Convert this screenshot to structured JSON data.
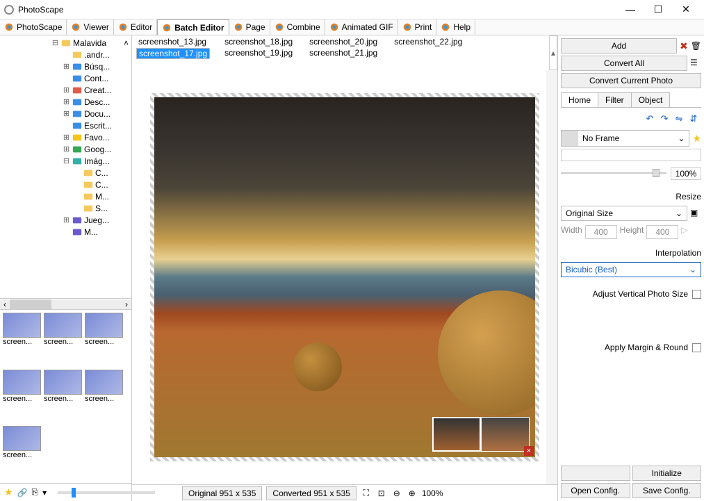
{
  "title": "PhotoScape",
  "toolbar": [
    {
      "label": "PhotoScape",
      "icon": "app-icon"
    },
    {
      "label": "Viewer",
      "icon": "viewer-icon"
    },
    {
      "label": "Editor",
      "icon": "editor-icon"
    },
    {
      "label": "Batch Editor",
      "icon": "batch-icon",
      "active": true
    },
    {
      "label": "Page",
      "icon": "page-icon"
    },
    {
      "label": "Combine",
      "icon": "combine-icon"
    },
    {
      "label": "Animated GIF",
      "icon": "gif-icon"
    },
    {
      "label": "Print",
      "icon": "print-icon"
    },
    {
      "label": "Help",
      "icon": "help-icon"
    }
  ],
  "tree": [
    {
      "indent": 0,
      "exp": "−",
      "icon": "folder",
      "label": "Malavida",
      "arrow": "^"
    },
    {
      "indent": 1,
      "exp": "",
      "icon": "folder",
      "label": ".andr..."
    },
    {
      "indent": 1,
      "exp": "+",
      "icon": "search",
      "label": "Búsq..."
    },
    {
      "indent": 1,
      "exp": "",
      "icon": "contacts",
      "label": "Cont..."
    },
    {
      "indent": 1,
      "exp": "+",
      "icon": "cloud",
      "label": "Creat..."
    },
    {
      "indent": 1,
      "exp": "+",
      "icon": "download",
      "label": "Desc..."
    },
    {
      "indent": 1,
      "exp": "+",
      "icon": "doc",
      "label": "Docu..."
    },
    {
      "indent": 1,
      "exp": "",
      "icon": "desktop",
      "label": "Escrit..."
    },
    {
      "indent": 1,
      "exp": "+",
      "icon": "star",
      "label": "Favo..."
    },
    {
      "indent": 1,
      "exp": "+",
      "icon": "gdrive",
      "label": "Goog..."
    },
    {
      "indent": 1,
      "exp": "−",
      "icon": "pictures",
      "label": "Imág..."
    },
    {
      "indent": 2,
      "exp": "",
      "icon": "folder",
      "label": "C..."
    },
    {
      "indent": 2,
      "exp": "",
      "icon": "folder",
      "label": "C..."
    },
    {
      "indent": 2,
      "exp": "",
      "icon": "folder",
      "label": "M..."
    },
    {
      "indent": 2,
      "exp": "",
      "icon": "folder",
      "label": "S..."
    },
    {
      "indent": 1,
      "exp": "+",
      "icon": "game",
      "label": "Jueg..."
    },
    {
      "indent": 1,
      "exp": "",
      "icon": "music",
      "label": "M..."
    }
  ],
  "thumbs": [
    "screen...",
    "screen...",
    "screen...",
    "screen...",
    "screen...",
    "screen...",
    "screen..."
  ],
  "filelist": [
    {
      "name": "screenshot_13.jpg"
    },
    {
      "name": "screenshot_17.jpg",
      "selected": true
    },
    {
      "name": "screenshot_18.jpg"
    },
    {
      "name": "screenshot_19.jpg"
    },
    {
      "name": "screenshot_20.jpg"
    },
    {
      "name": "screenshot_21.jpg"
    },
    {
      "name": "screenshot_22.jpg"
    }
  ],
  "right": {
    "add": "Add",
    "convert_all": "Convert All",
    "convert_current": "Convert Current Photo",
    "tabs": [
      "Home",
      "Filter",
      "Object"
    ],
    "frame": "No Frame",
    "opacity": "100%",
    "resize_label": "Resize",
    "size_mode": "Original Size",
    "width_label": "Width",
    "width": "400",
    "height_label": "Height",
    "height": "400",
    "interp_label": "Interpolation",
    "interp": "Bicubic (Best)",
    "adjust_vertical": "Adjust Vertical Photo Size",
    "apply_margin": "Apply Margin & Round",
    "initialize": "Initialize",
    "open_cfg": "Open Config.",
    "save_cfg": "Save Config."
  },
  "status": {
    "original": "Original 951 x 535",
    "converted": "Converted 951 x 535",
    "zoom": "100%"
  }
}
